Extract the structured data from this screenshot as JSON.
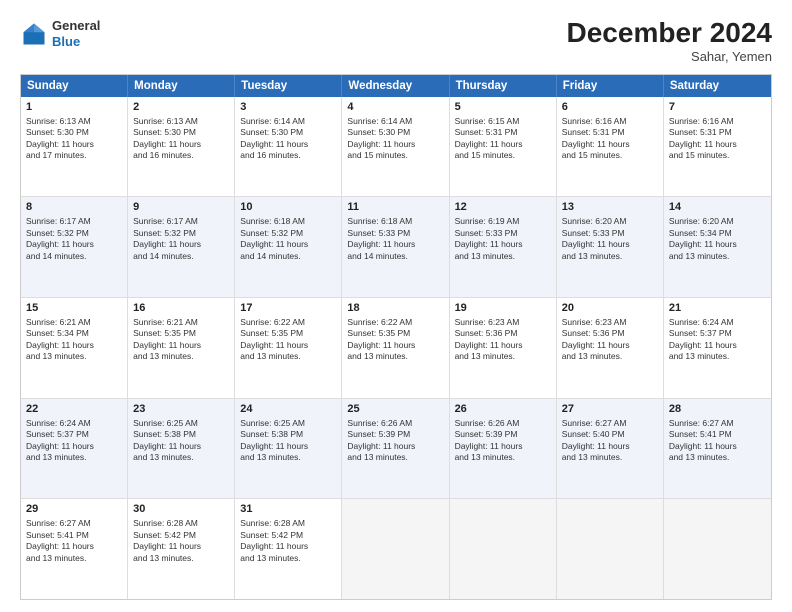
{
  "header": {
    "logo_general": "General",
    "logo_blue": "Blue",
    "month_year": "December 2024",
    "location": "Sahar, Yemen"
  },
  "days_of_week": [
    "Sunday",
    "Monday",
    "Tuesday",
    "Wednesday",
    "Thursday",
    "Friday",
    "Saturday"
  ],
  "weeks": [
    [
      {
        "day": "1",
        "info": "Sunrise: 6:13 AM\nSunset: 5:30 PM\nDaylight: 11 hours\nand 17 minutes."
      },
      {
        "day": "2",
        "info": "Sunrise: 6:13 AM\nSunset: 5:30 PM\nDaylight: 11 hours\nand 16 minutes."
      },
      {
        "day": "3",
        "info": "Sunrise: 6:14 AM\nSunset: 5:30 PM\nDaylight: 11 hours\nand 16 minutes."
      },
      {
        "day": "4",
        "info": "Sunrise: 6:14 AM\nSunset: 5:30 PM\nDaylight: 11 hours\nand 15 minutes."
      },
      {
        "day": "5",
        "info": "Sunrise: 6:15 AM\nSunset: 5:31 PM\nDaylight: 11 hours\nand 15 minutes."
      },
      {
        "day": "6",
        "info": "Sunrise: 6:16 AM\nSunset: 5:31 PM\nDaylight: 11 hours\nand 15 minutes."
      },
      {
        "day": "7",
        "info": "Sunrise: 6:16 AM\nSunset: 5:31 PM\nDaylight: 11 hours\nand 15 minutes."
      }
    ],
    [
      {
        "day": "8",
        "info": "Sunrise: 6:17 AM\nSunset: 5:32 PM\nDaylight: 11 hours\nand 14 minutes."
      },
      {
        "day": "9",
        "info": "Sunrise: 6:17 AM\nSunset: 5:32 PM\nDaylight: 11 hours\nand 14 minutes."
      },
      {
        "day": "10",
        "info": "Sunrise: 6:18 AM\nSunset: 5:32 PM\nDaylight: 11 hours\nand 14 minutes."
      },
      {
        "day": "11",
        "info": "Sunrise: 6:18 AM\nSunset: 5:33 PM\nDaylight: 11 hours\nand 14 minutes."
      },
      {
        "day": "12",
        "info": "Sunrise: 6:19 AM\nSunset: 5:33 PM\nDaylight: 11 hours\nand 13 minutes."
      },
      {
        "day": "13",
        "info": "Sunrise: 6:20 AM\nSunset: 5:33 PM\nDaylight: 11 hours\nand 13 minutes."
      },
      {
        "day": "14",
        "info": "Sunrise: 6:20 AM\nSunset: 5:34 PM\nDaylight: 11 hours\nand 13 minutes."
      }
    ],
    [
      {
        "day": "15",
        "info": "Sunrise: 6:21 AM\nSunset: 5:34 PM\nDaylight: 11 hours\nand 13 minutes."
      },
      {
        "day": "16",
        "info": "Sunrise: 6:21 AM\nSunset: 5:35 PM\nDaylight: 11 hours\nand 13 minutes."
      },
      {
        "day": "17",
        "info": "Sunrise: 6:22 AM\nSunset: 5:35 PM\nDaylight: 11 hours\nand 13 minutes."
      },
      {
        "day": "18",
        "info": "Sunrise: 6:22 AM\nSunset: 5:35 PM\nDaylight: 11 hours\nand 13 minutes."
      },
      {
        "day": "19",
        "info": "Sunrise: 6:23 AM\nSunset: 5:36 PM\nDaylight: 11 hours\nand 13 minutes."
      },
      {
        "day": "20",
        "info": "Sunrise: 6:23 AM\nSunset: 5:36 PM\nDaylight: 11 hours\nand 13 minutes."
      },
      {
        "day": "21",
        "info": "Sunrise: 6:24 AM\nSunset: 5:37 PM\nDaylight: 11 hours\nand 13 minutes."
      }
    ],
    [
      {
        "day": "22",
        "info": "Sunrise: 6:24 AM\nSunset: 5:37 PM\nDaylight: 11 hours\nand 13 minutes."
      },
      {
        "day": "23",
        "info": "Sunrise: 6:25 AM\nSunset: 5:38 PM\nDaylight: 11 hours\nand 13 minutes."
      },
      {
        "day": "24",
        "info": "Sunrise: 6:25 AM\nSunset: 5:38 PM\nDaylight: 11 hours\nand 13 minutes."
      },
      {
        "day": "25",
        "info": "Sunrise: 6:26 AM\nSunset: 5:39 PM\nDaylight: 11 hours\nand 13 minutes."
      },
      {
        "day": "26",
        "info": "Sunrise: 6:26 AM\nSunset: 5:39 PM\nDaylight: 11 hours\nand 13 minutes."
      },
      {
        "day": "27",
        "info": "Sunrise: 6:27 AM\nSunset: 5:40 PM\nDaylight: 11 hours\nand 13 minutes."
      },
      {
        "day": "28",
        "info": "Sunrise: 6:27 AM\nSunset: 5:41 PM\nDaylight: 11 hours\nand 13 minutes."
      }
    ],
    [
      {
        "day": "29",
        "info": "Sunrise: 6:27 AM\nSunset: 5:41 PM\nDaylight: 11 hours\nand 13 minutes."
      },
      {
        "day": "30",
        "info": "Sunrise: 6:28 AM\nSunset: 5:42 PM\nDaylight: 11 hours\nand 13 minutes."
      },
      {
        "day": "31",
        "info": "Sunrise: 6:28 AM\nSunset: 5:42 PM\nDaylight: 11 hours\nand 13 minutes."
      },
      {
        "day": "",
        "info": ""
      },
      {
        "day": "",
        "info": ""
      },
      {
        "day": "",
        "info": ""
      },
      {
        "day": "",
        "info": ""
      }
    ]
  ]
}
